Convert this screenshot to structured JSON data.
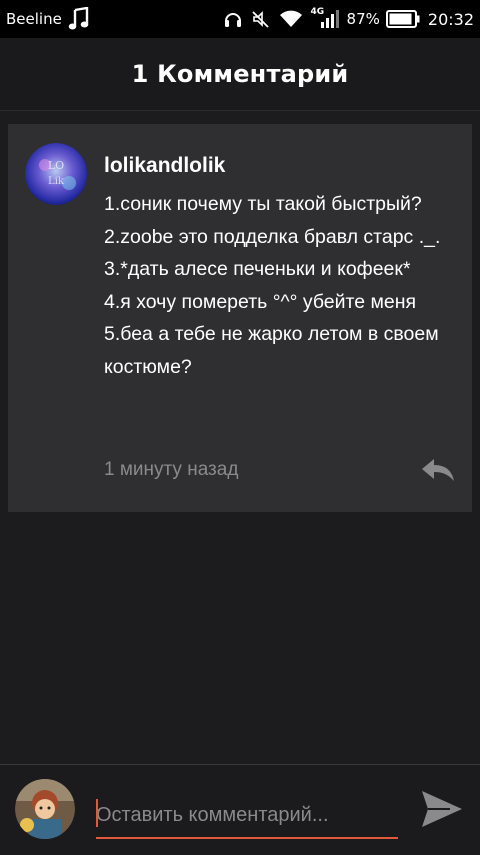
{
  "status_bar": {
    "carrier": "Beeline",
    "network": "4G",
    "battery_percent": "87%",
    "time": "20:32",
    "icons": [
      "music-note-icon",
      "headphones-icon",
      "mute-icon",
      "wifi-icon",
      "signal-icon",
      "battery-icon"
    ]
  },
  "header": {
    "title": "1 Комментарий"
  },
  "comment": {
    "username": "lolikandlolik",
    "avatar_text": "LO Lik",
    "lines": [
      "1.соник почему ты такой быстрый?",
      "2.zoobe это подделка бравл старс ._.",
      "3.*дать алесе печеньки и кофеек*",
      "4.я хочу помереть °^° убейте меня",
      "5.беа а тебе не жарко летом в своем костюме?"
    ],
    "timestamp": "1 минуту назад",
    "reply_icon": "reply-icon"
  },
  "input": {
    "placeholder": "Оставить комментарий...",
    "value": "",
    "send_icon": "send-icon"
  },
  "colors": {
    "background": "#1c1b1d",
    "card": "#2f2e30",
    "accent": "#e2593a",
    "muted_text": "#8a898b"
  }
}
